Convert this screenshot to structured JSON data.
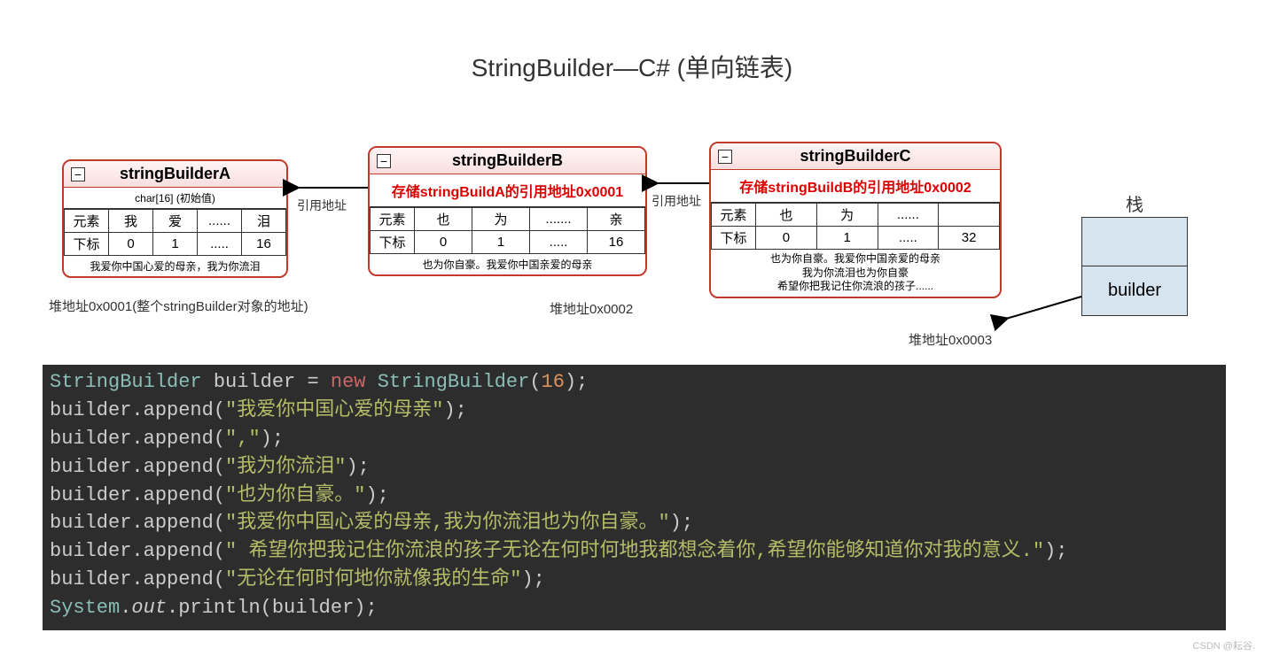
{
  "title": "StringBuilder—C#   (单向链表)",
  "boxA": {
    "name": "stringBuilderA",
    "sub": "char[16]  (初始值)",
    "row1": [
      "元素",
      "我",
      "爱",
      "......",
      "泪"
    ],
    "row2": [
      "下标",
      "0",
      "1",
      ".....",
      "16"
    ],
    "footer": "我爱你中国心爱的母亲，我为你流泪",
    "caption": "堆地址0x0001(整个stringBuilder对象的地址)"
  },
  "boxB": {
    "name": "stringBuilderB",
    "ref": "存储stringBuildA的引用地址0x0001",
    "row1": [
      "元素",
      "也",
      "为",
      ".......",
      "亲"
    ],
    "row2": [
      "下标",
      "0",
      "1",
      ".....",
      "16"
    ],
    "footer": "也为你自豪。我爱你中国亲爱的母亲",
    "caption": "堆地址0x0002"
  },
  "boxC": {
    "name": "stringBuilderC",
    "ref": "存储stringBuildB的引用地址0x0002",
    "row1": [
      "元素",
      "也",
      "为",
      "......",
      ""
    ],
    "row2": [
      "下标",
      "0",
      "1",
      ".....",
      "32"
    ],
    "footer1": "也为你自豪。我爱你中国亲爱的母亲",
    "footer2": "我为你流泪也为你自豪",
    "footer3": "希望你把我记住你流浪的孩子......",
    "caption": "堆地址0x0003"
  },
  "arrowLabelBA": "引用地址",
  "arrowLabelCB": "引用地址",
  "stack": {
    "label": "栈",
    "cell": "builder"
  },
  "code": {
    "l1_type": "StringBuilder",
    "l1_var": "builder",
    "l1_eq": "=",
    "l1_new": "new",
    "l1_ctor": "StringBuilder",
    "l1_num": "16",
    "l2_obj": "builder",
    "l2_m": "append",
    "l2_s": "\"我爱你中国心爱的母亲\"",
    "l3_obj": "builder",
    "l3_m": "append",
    "l3_s": "\",\"",
    "l4_obj": "builder",
    "l4_m": "append",
    "l4_s": "\"我为你流泪\"",
    "l5_obj": "builder",
    "l5_m": "append",
    "l5_s": "\"也为你自豪。\"",
    "l6_obj": "builder",
    "l6_m": "append",
    "l6_s": "\"我爱你中国心爱的母亲,我为你流泪也为你自豪。\"",
    "l7_obj": "builder",
    "l7_m": "append",
    "l7_s": "\" 希望你把我记住你流浪的孩子无论在何时何地我都想念着你,希望你能够知道你对我的意义.\"",
    "l8_obj": "builder",
    "l8_m": "append",
    "l8_s": "\"无论在何时何地你就像我的生命\"",
    "l9_cls": "System",
    "l9_out": "out",
    "l9_m": "println",
    "l9_arg": "builder"
  },
  "watermark": "CSDN @耘谷."
}
